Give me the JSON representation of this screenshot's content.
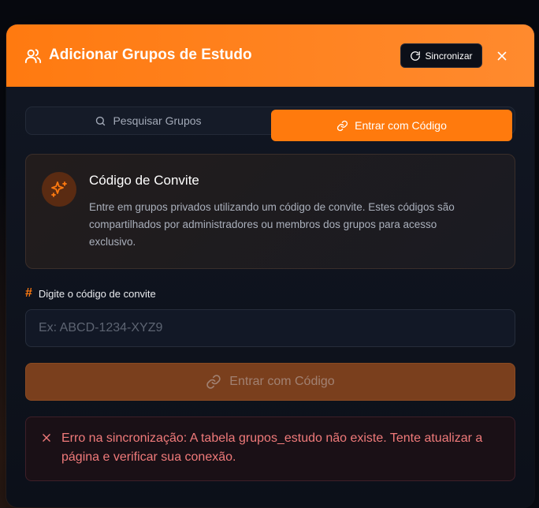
{
  "header": {
    "title": "Adicionar Grupos de Estudo",
    "sync_label": "Sincronizar",
    "accent": "#ff7a10"
  },
  "tabs": [
    {
      "label": "Pesquisar Grupos",
      "icon": "search-icon",
      "active": false
    },
    {
      "label": "Entrar com Código",
      "icon": "link-icon",
      "active": true
    }
  ],
  "info": {
    "title": "Código de Convite",
    "description": "Entre em grupos privados utilizando um código de convite. Estes códigos são compartilhados por administradores ou membros dos grupos para acesso exclusivo.",
    "icon": "sparkle-icon"
  },
  "form": {
    "label": "Digite o código de convite",
    "placeholder": "Ex: ABCD-1234-XYZ9",
    "value": "",
    "submit_label": "Entrar com Código"
  },
  "error": {
    "message": "Erro na sincronização: A tabela grupos_estudo não existe. Tente atualizar a página e verificar sua conexão.",
    "color": "#f07a7a"
  }
}
